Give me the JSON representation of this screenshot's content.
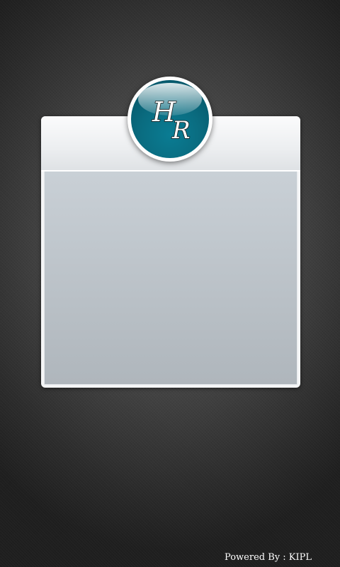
{
  "logo": {
    "letter_1": "H",
    "letter_2": "R",
    "colors": {
      "ring": "#ffffff",
      "fill": "#0a6c80"
    }
  },
  "footer": {
    "text": "Powered By : KIPL"
  },
  "colors": {
    "background": "#3f3f3f",
    "panel_header": "#eceef0",
    "panel_body": "#bcc3c9"
  }
}
